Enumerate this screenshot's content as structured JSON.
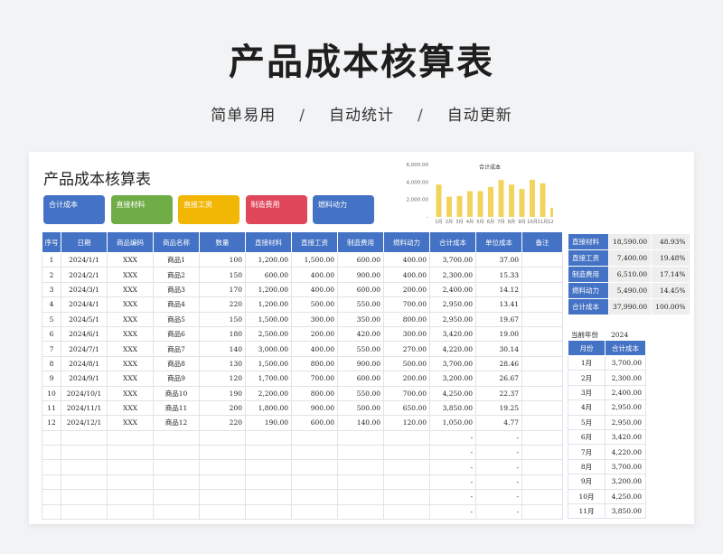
{
  "hero": {
    "title": "产品成本核算表",
    "sub1": "简单易用",
    "sep": "/",
    "sub2": "自动统计",
    "sub3": "自动更新"
  },
  "sheet_title": "产品成本核算表",
  "cards": [
    {
      "label": "合计成本",
      "color": "#4472c4"
    },
    {
      "label": "直接材料",
      "color": "#70ad47"
    },
    {
      "label": "直接工资",
      "color": "#f2b705"
    },
    {
      "label": "制造费用",
      "color": "#e0475b"
    },
    {
      "label": "燃料动力",
      "color": "#4472c4"
    }
  ],
  "chart_data": {
    "type": "bar",
    "title": "合计成本",
    "categories": [
      "1月",
      "2月",
      "3月",
      "4月",
      "5月",
      "6月",
      "7月",
      "8月",
      "9月",
      "10月",
      "11月",
      "12月"
    ],
    "values": [
      3700,
      2300,
      2400,
      2950,
      2950,
      3420,
      4220,
      3700,
      3200,
      4250,
      3850,
      1050
    ],
    "yticks": [
      "6,000.00",
      "4,000.00",
      "2,000.00",
      "-"
    ],
    "ylim": [
      0,
      6000
    ],
    "color": "#f2d45c"
  },
  "table": {
    "headers": [
      "序号",
      "日期",
      "商品编码",
      "商品名称",
      "数量",
      "直接材料",
      "直接工资",
      "制造费用",
      "燃料动力",
      "合计成本",
      "单位成本",
      "备注"
    ],
    "rows": [
      [
        "1",
        "2024/1/1",
        "XXX",
        "商品1",
        "100",
        "1,200.00",
        "1,500.00",
        "600.00",
        "400.00",
        "3,700.00",
        "37.00",
        ""
      ],
      [
        "2",
        "2024/2/1",
        "XXX",
        "商品2",
        "150",
        "600.00",
        "400.00",
        "900.00",
        "400.00",
        "2,300.00",
        "15.33",
        ""
      ],
      [
        "3",
        "2024/3/1",
        "XXX",
        "商品3",
        "170",
        "1,200.00",
        "400.00",
        "600.00",
        "200.00",
        "2,400.00",
        "14.12",
        ""
      ],
      [
        "4",
        "2024/4/1",
        "XXX",
        "商品4",
        "220",
        "1,200.00",
        "500.00",
        "550.00",
        "700.00",
        "2,950.00",
        "13.41",
        ""
      ],
      [
        "5",
        "2024/5/1",
        "XXX",
        "商品5",
        "150",
        "1,500.00",
        "300.00",
        "350.00",
        "800.00",
        "2,950.00",
        "19.67",
        ""
      ],
      [
        "6",
        "2024/6/1",
        "XXX",
        "商品6",
        "180",
        "2,500.00",
        "200.00",
        "420.00",
        "300.00",
        "3,420.00",
        "19.00",
        ""
      ],
      [
        "7",
        "2024/7/1",
        "XXX",
        "商品7",
        "140",
        "3,000.00",
        "400.00",
        "550.00",
        "270.00",
        "4,220.00",
        "30.14",
        ""
      ],
      [
        "8",
        "2024/8/1",
        "XXX",
        "商品8",
        "130",
        "1,500.00",
        "800.00",
        "900.00",
        "500.00",
        "3,700.00",
        "28.46",
        ""
      ],
      [
        "9",
        "2024/9/1",
        "XXX",
        "商品9",
        "120",
        "1,700.00",
        "700.00",
        "600.00",
        "200.00",
        "3,200.00",
        "26.67",
        ""
      ],
      [
        "10",
        "2024/10/1",
        "XXX",
        "商品10",
        "190",
        "2,200.00",
        "800.00",
        "550.00",
        "700.00",
        "4,250.00",
        "22.37",
        ""
      ],
      [
        "11",
        "2024/11/1",
        "XXX",
        "商品11",
        "200",
        "1,800.00",
        "900.00",
        "500.00",
        "650.00",
        "3,850.00",
        "19.25",
        ""
      ],
      [
        "12",
        "2024/12/1",
        "XXX",
        "商品12",
        "220",
        "190.00",
        "600.00",
        "140.00",
        "120.00",
        "1,050.00",
        "4.77",
        ""
      ],
      [
        "",
        "",
        "",
        "",
        "",
        "",
        "",
        "",
        "",
        "-",
        "-",
        ""
      ],
      [
        "",
        "",
        "",
        "",
        "",
        "",
        "",
        "",
        "",
        "-",
        "-",
        ""
      ],
      [
        "",
        "",
        "",
        "",
        "",
        "",
        "",
        "",
        "",
        "-",
        "-",
        ""
      ],
      [
        "",
        "",
        "",
        "",
        "",
        "",
        "",
        "",
        "",
        "-",
        "-",
        ""
      ],
      [
        "",
        "",
        "",
        "",
        "",
        "",
        "",
        "",
        "",
        "-",
        "-",
        ""
      ],
      [
        "",
        "",
        "",
        "",
        "",
        "",
        "",
        "",
        "",
        "-",
        "-",
        ""
      ]
    ]
  },
  "summary": [
    {
      "label": "直接材料",
      "value": "18,590.00",
      "pct": "48.93%"
    },
    {
      "label": "直接工资",
      "value": "7,400.00",
      "pct": "19.48%"
    },
    {
      "label": "制造费用",
      "value": "6,510.00",
      "pct": "17.14%"
    },
    {
      "label": "燃料动力",
      "value": "5,490.00",
      "pct": "14.45%"
    },
    {
      "label": "合计成本",
      "value": "37,990.00",
      "pct": "100.00%"
    }
  ],
  "year": {
    "label": "当前年份",
    "value": "2024"
  },
  "monthly": {
    "headers": [
      "月份",
      "合计成本"
    ],
    "rows": [
      [
        "1月",
        "3,700.00"
      ],
      [
        "2月",
        "2,300.00"
      ],
      [
        "3月",
        "2,400.00"
      ],
      [
        "4月",
        "2,950.00"
      ],
      [
        "5月",
        "2,950.00"
      ],
      [
        "6月",
        "3,420.00"
      ],
      [
        "7月",
        "4,220.00"
      ],
      [
        "8月",
        "3,700.00"
      ],
      [
        "9月",
        "3,200.00"
      ],
      [
        "10月",
        "4,250.00"
      ],
      [
        "11月",
        "3,850.00"
      ]
    ]
  }
}
